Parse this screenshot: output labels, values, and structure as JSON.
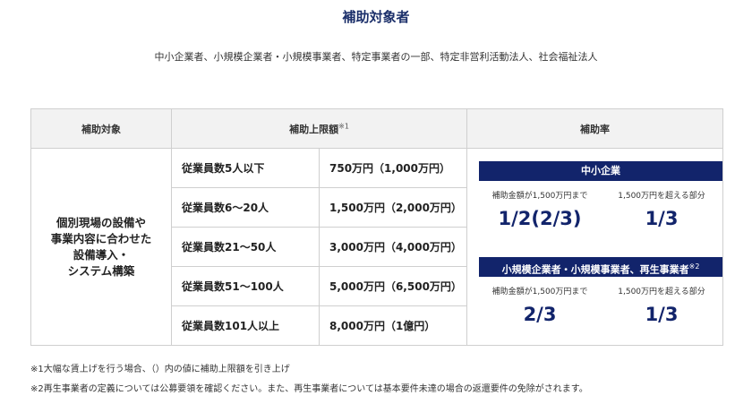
{
  "title": "補助対象者",
  "subtitle": "中小企業者、小規模企業者・小規模事業者、特定事業者の一部、特定非営利活動法人、社会福祉法人",
  "table": {
    "headers": {
      "target": "補助対象",
      "limit": "補助上限額",
      "limit_mark": "※1",
      "rate": "補助率"
    },
    "target_lines": [
      "個別現場の設備や",
      "事業内容に合わせた",
      "設備導入・",
      "システム構築"
    ],
    "rows": [
      {
        "employees": "従業員数5人以下",
        "amount": "750万円（1,000万円）"
      },
      {
        "employees": "従業員数6〜20人",
        "amount": "1,500万円（2,000万円）"
      },
      {
        "employees": "従業員数21〜50人",
        "amount": "3,000万円（4,000万円）"
      },
      {
        "employees": "従業員数51〜100人",
        "amount": "5,000万円（6,500万円）"
      },
      {
        "employees": "従業員数101人以上",
        "amount": "8,000万円（1億円）"
      }
    ],
    "rate_blocks": [
      {
        "title": "中小企業",
        "title_mark": "",
        "cond_left": "補助金額が1,500万円まで",
        "cond_right": "1,500万円を超える部分",
        "rate_left": "1/2(2/3)",
        "rate_right": "1/3"
      },
      {
        "title": "小規模企業者・小規模事業者、再生事業者",
        "title_mark": "※2",
        "cond_left": "補助金額が1,500万円まで",
        "cond_right": "1,500万円を超える部分",
        "rate_left": "2/3",
        "rate_right": "1/3"
      }
    ]
  },
  "notes": [
    "※1大幅な賃上げを行う場合、（）内の値に補助上限額を引き上げ",
    "※2再生事業者の定義については公募要領を確認ください。また、再生事業者については基本要件未達の場合の返還要件の免除がされます。"
  ],
  "colors": {
    "accent": "#12246b",
    "header_bg": "#f2f2f2",
    "border": "#cfcfcf"
  }
}
